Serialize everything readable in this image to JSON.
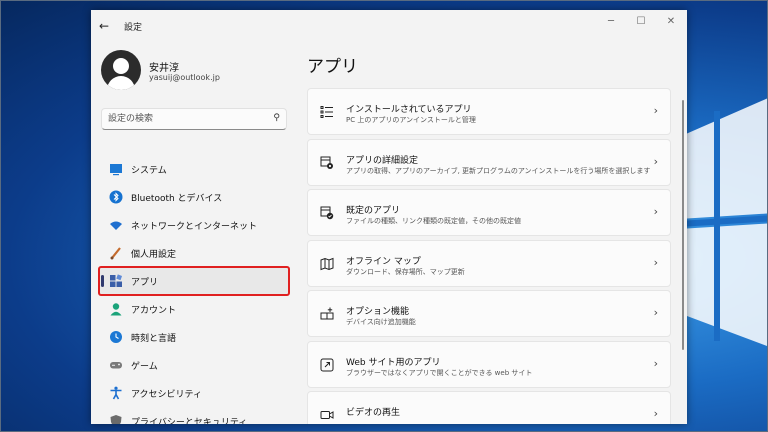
{
  "window": {
    "title": "設定",
    "back_icon": "back-arrow-icon"
  },
  "controls": {
    "minimize": "─",
    "maximize": "☐",
    "close": "✕"
  },
  "user": {
    "name": "安井淳",
    "email": "yasuij@outlook.jp"
  },
  "search": {
    "placeholder": "設定の検索"
  },
  "sidebar": {
    "items": [
      {
        "label": "システム",
        "icon": "display-icon",
        "color": "#1c78d4"
      },
      {
        "label": "Bluetooth とデバイス",
        "icon": "bluetooth-icon",
        "color": "#1672d0"
      },
      {
        "label": "ネットワークとインターネット",
        "icon": "wifi-icon",
        "color": "#1f6fcf"
      },
      {
        "label": "個人用設定",
        "icon": "paintbrush-icon",
        "color": "#c46b2d"
      },
      {
        "label": "アプリ",
        "icon": "apps-icon",
        "color": "#3a5ea8",
        "active": true
      },
      {
        "label": "アカウント",
        "icon": "account-icon",
        "color": "#1ba37a"
      },
      {
        "label": "時刻と言語",
        "icon": "globe-clock-icon",
        "color": "#1c78d4"
      },
      {
        "label": "ゲーム",
        "icon": "gamepad-icon",
        "color": "#7a7a7a"
      },
      {
        "label": "アクセシビリティ",
        "icon": "accessibility-icon",
        "color": "#1c6fd0"
      },
      {
        "label": "プライバシーとセキュリティ",
        "icon": "shield-icon",
        "color": "#6b6b6b"
      }
    ]
  },
  "main": {
    "title": "アプリ",
    "cards": [
      {
        "title": "インストールされているアプリ",
        "subtitle": "PC 上のアプリのアンインストールと管理",
        "icon": "list-icon"
      },
      {
        "title": "アプリの詳細設定",
        "subtitle": "アプリの取得、アプリのアーカイブ, 更新プログラムのアンインストールを行う場所を選択します",
        "icon": "app-settings-icon"
      },
      {
        "title": "既定のアプリ",
        "subtitle": "ファイルの種類、リンク種類の既定値，その他の既定値",
        "icon": "default-apps-icon"
      },
      {
        "title": "オフライン マップ",
        "subtitle": "ダウンロード、保存場所、マップ更新",
        "icon": "map-icon"
      },
      {
        "title": "オプション機能",
        "subtitle": "デバイス向け追加機能",
        "icon": "optional-features-icon"
      },
      {
        "title": "Web サイト用のアプリ",
        "subtitle": "ブラウザーではなくアプリで開くことができる web サイト",
        "icon": "web-link-icon"
      },
      {
        "title": "ビデオの再生",
        "subtitle": "",
        "icon": "video-icon"
      }
    ]
  },
  "colors": {
    "accent": "#303a6e",
    "highlight_border": "#e02020"
  }
}
